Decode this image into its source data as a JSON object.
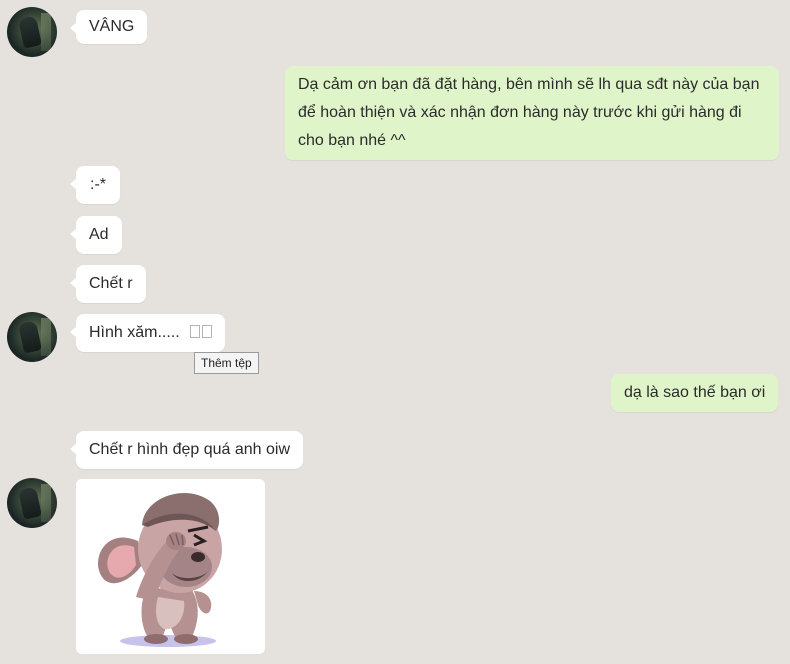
{
  "messages": {
    "vang": "VÂNG",
    "thanks": "Dạ cảm ơn bạn đã đặt hàng, bên mình sẽ lh qua sđt này của bạn để hoàn thiện và xác nhận đơn hàng này trước khi gửi hàng đi cho bạn nhé ^^",
    "kiss": ":-*",
    "ad": "Ad",
    "chet_r": "Chết r",
    "hinh_xam": "Hình xăm.....",
    "hinh_xam_symbols": "two-unrendered-emoji-boxes",
    "da_la_sao": "dạ là sao thế bạn ơi",
    "chet_r_hinh": "Chết r hình đẹp quá anh oiw"
  },
  "tooltip": {
    "label": "Thêm tệp"
  },
  "sticker": {
    "icon": "facepalm-bulldog-sticker"
  },
  "colors": {
    "background": "#e5e1dc",
    "incoming_bubble": "#ffffff",
    "outgoing_bubble": "#dff5c9"
  }
}
